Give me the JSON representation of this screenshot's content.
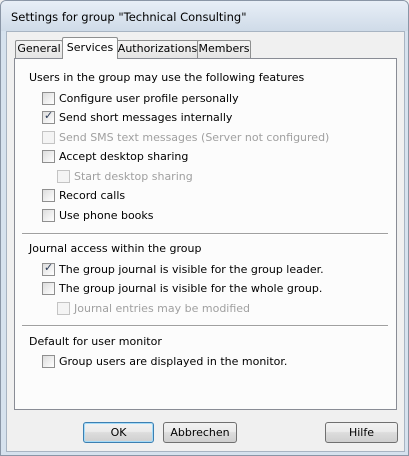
{
  "window": {
    "title": "Settings for group \"Technical Consulting\""
  },
  "tabs": [
    {
      "label": "General"
    },
    {
      "label": "Services"
    },
    {
      "label": "Authorizations"
    },
    {
      "label": "Members"
    }
  ],
  "active_tab": "Services",
  "sections": {
    "features": {
      "title": "Users in the group may use the following features",
      "items": [
        {
          "label": "Configure user profile personally",
          "checked": false,
          "enabled": true
        },
        {
          "label": "Send short messages internally",
          "checked": true,
          "enabled": true
        },
        {
          "label": "Send SMS text messages (Server not configured)",
          "checked": false,
          "enabled": false
        },
        {
          "label": "Accept desktop sharing",
          "checked": false,
          "enabled": true
        },
        {
          "label": "Start desktop sharing",
          "checked": false,
          "enabled": false
        },
        {
          "label": "Record calls",
          "checked": false,
          "enabled": true
        },
        {
          "label": "Use phone books",
          "checked": false,
          "enabled": true
        }
      ]
    },
    "journal": {
      "title": "Journal access within the group",
      "items": [
        {
          "label": "The group journal is visible for the group leader.",
          "checked": true,
          "enabled": true
        },
        {
          "label": "The group journal is visible for the whole group.",
          "checked": false,
          "enabled": true
        },
        {
          "label": "Journal entries may be modified",
          "checked": false,
          "enabled": false
        }
      ]
    },
    "monitor": {
      "title": "Default for user monitor",
      "items": [
        {
          "label": "Group users are displayed in the monitor.",
          "checked": false,
          "enabled": true
        }
      ]
    }
  },
  "buttons": {
    "ok": "OK",
    "cancel": "Abbrechen",
    "help": "Hilfe"
  }
}
